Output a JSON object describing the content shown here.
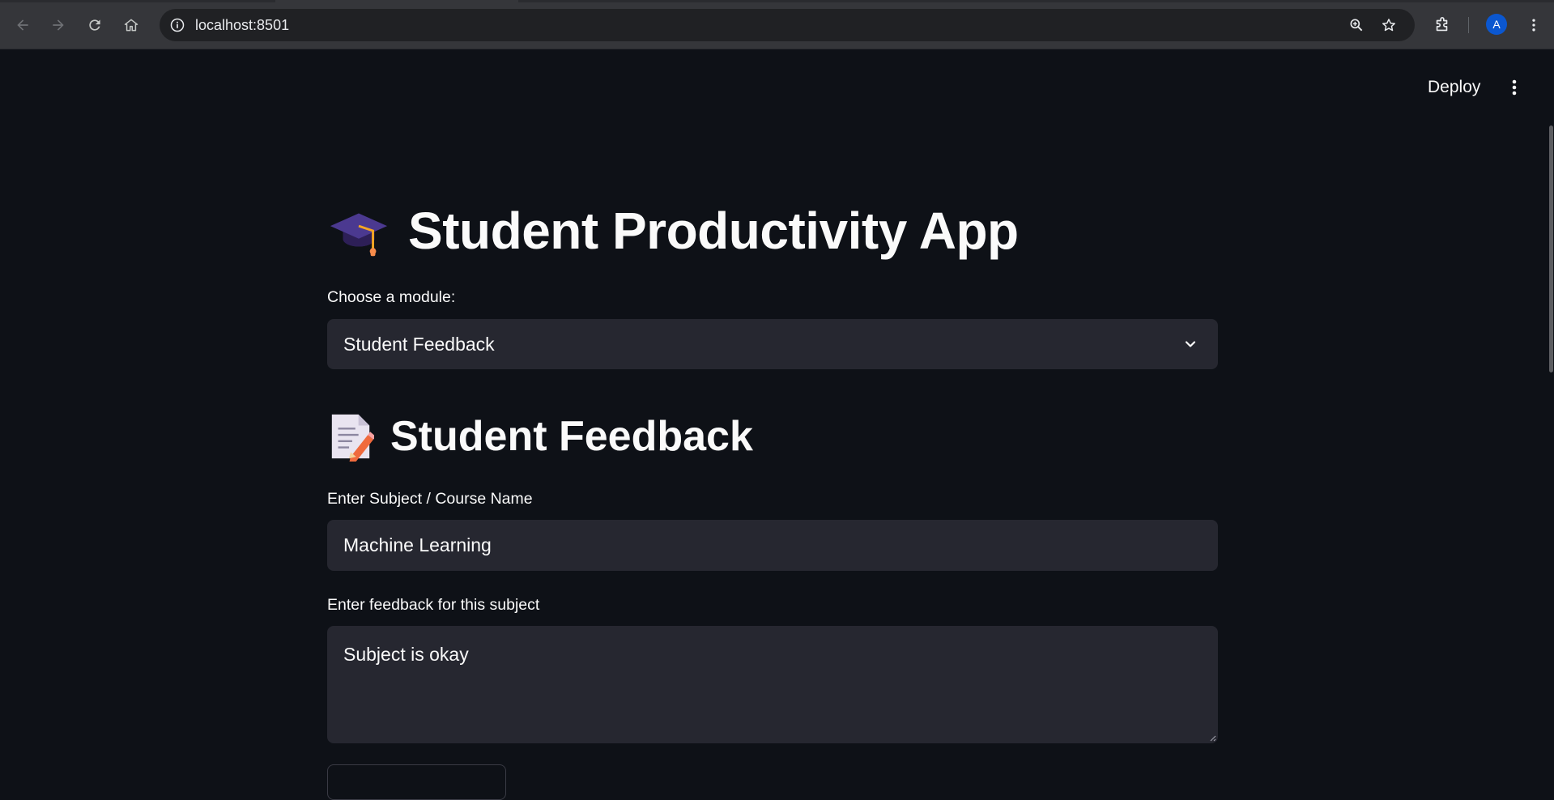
{
  "browser": {
    "url": "localhost:8501",
    "profile_initial": "A",
    "icons": {
      "back": "arrow-left-icon",
      "forward": "arrow-right-icon",
      "reload": "reload-icon",
      "home": "home-icon",
      "site_info": "info-icon",
      "zoom": "zoom-in-icon",
      "bookmark": "star-icon",
      "extensions": "puzzle-icon",
      "menu": "kebab-menu-icon"
    }
  },
  "header": {
    "deploy_label": "Deploy"
  },
  "app": {
    "title_emoji": "🎓",
    "title": "Student Productivity App",
    "module_label": "Choose a module:",
    "module_selected": "Student Feedback",
    "section_emoji": "📝",
    "section_title": "Student Feedback",
    "subject_label": "Enter Subject / Course Name",
    "subject_value": "Machine Learning",
    "feedback_label": "Enter feedback for this subject",
    "feedback_value": "Subject is okay"
  },
  "colors": {
    "background": "#0e1117",
    "widget": "#262730",
    "text": "#fafafa",
    "chrome": "#35363a",
    "omnibox": "#202124",
    "avatar": "#0b57d0"
  }
}
